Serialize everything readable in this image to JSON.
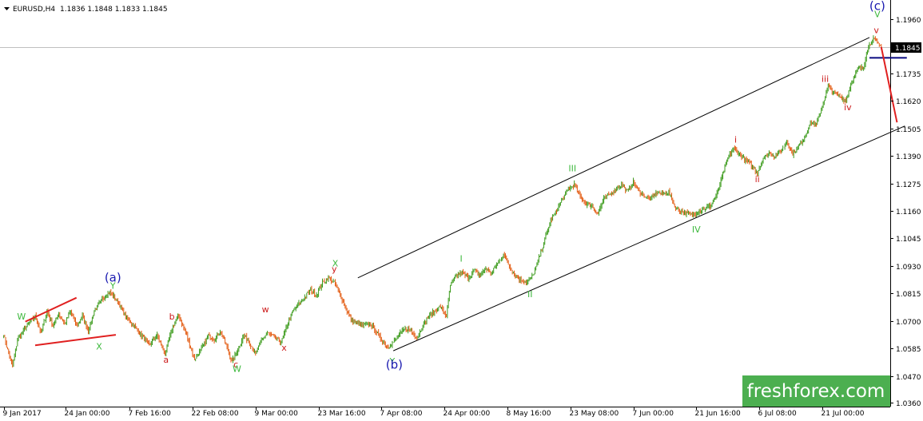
{
  "header": {
    "symbol": "EURUSD,H4",
    "ohlc": "1.1836 1.1848 1.1833 1.1845"
  },
  "brand": {
    "text": "freshforex.com",
    "bg": "#4caf50"
  },
  "chart_data": {
    "type": "candlestick",
    "symbol": "EURUSD",
    "timeframe": "H4",
    "current_price": 1.1845,
    "current_price_label": "1.1845",
    "ylim": [
      1.0345,
      1.2035
    ],
    "y_ticks": [
      {
        "value": 1.196,
        "label": "1.1960"
      },
      {
        "value": 1.1735,
        "label": "1.1735"
      },
      {
        "value": 1.162,
        "label": "1.1620"
      },
      {
        "value": 1.1505,
        "label": "1.1505"
      },
      {
        "value": 1.139,
        "label": "1.1390"
      },
      {
        "value": 1.1275,
        "label": "1.1275"
      },
      {
        "value": 1.116,
        "label": "1.1160"
      },
      {
        "value": 1.1045,
        "label": "1.1045"
      },
      {
        "value": 1.093,
        "label": "1.0930"
      },
      {
        "value": 1.0815,
        "label": "1.0815"
      },
      {
        "value": 1.07,
        "label": "1.0700"
      },
      {
        "value": 1.0585,
        "label": "1.0585"
      },
      {
        "value": 1.047,
        "label": "1.0470"
      },
      {
        "value": 1.036,
        "label": "1.0360"
      }
    ],
    "x_labels": [
      {
        "index": 0,
        "label": "9 Jan 2017"
      },
      {
        "index": 63,
        "label": "24 Jan 00:00"
      },
      {
        "index": 128,
        "label": "7 Feb 16:00"
      },
      {
        "index": 192,
        "label": "22 Feb 08:00"
      },
      {
        "index": 256,
        "label": "9 Mar 00:00"
      },
      {
        "index": 320,
        "label": "23 Mar 16:00"
      },
      {
        "index": 384,
        "label": "7 Apr 08:00"
      },
      {
        "index": 448,
        "label": "24 Apr 00:00"
      },
      {
        "index": 512,
        "label": "8 May 16:00"
      },
      {
        "index": 576,
        "label": "23 May 08:00"
      },
      {
        "index": 640,
        "label": "7 Jun 00:00"
      },
      {
        "index": 704,
        "label": "21 Jun 16:00"
      },
      {
        "index": 768,
        "label": "6 Jul 08:00"
      },
      {
        "index": 832,
        "label": "21 Jul 00:00"
      }
    ],
    "bar_count": 900,
    "up_color": "#3a9a1a",
    "down_color": "#e35a10",
    "price_path": [
      [
        0,
        1.064
      ],
      [
        4,
        1.058
      ],
      [
        9,
        1.051
      ],
      [
        14,
        1.062
      ],
      [
        20,
        1.066
      ],
      [
        26,
        1.069
      ],
      [
        32,
        1.072
      ],
      [
        38,
        1.065
      ],
      [
        44,
        1.074
      ],
      [
        50,
        1.068
      ],
      [
        56,
        1.073
      ],
      [
        62,
        1.069
      ],
      [
        68,
        1.074
      ],
      [
        74,
        1.068
      ],
      [
        80,
        1.072
      ],
      [
        86,
        1.066
      ],
      [
        92,
        1.074
      ],
      [
        100,
        1.079
      ],
      [
        108,
        1.082
      ],
      [
        116,
        1.078
      ],
      [
        124,
        1.072
      ],
      [
        132,
        1.068
      ],
      [
        140,
        1.064
      ],
      [
        148,
        1.06
      ],
      [
        156,
        1.064
      ],
      [
        164,
        1.056
      ],
      [
        172,
        1.068
      ],
      [
        178,
        1.072
      ],
      [
        186,
        1.064
      ],
      [
        194,
        1.054
      ],
      [
        202,
        1.059
      ],
      [
        208,
        1.064
      ],
      [
        214,
        1.062
      ],
      [
        220,
        1.066
      ],
      [
        226,
        1.06
      ],
      [
        232,
        1.053
      ],
      [
        238,
        1.058
      ],
      [
        244,
        1.064
      ],
      [
        250,
        1.061
      ],
      [
        256,
        1.056
      ],
      [
        262,
        1.062
      ],
      [
        268,
        1.065
      ],
      [
        276,
        1.063
      ],
      [
        282,
        1.061
      ],
      [
        288,
        1.068
      ],
      [
        294,
        1.074
      ],
      [
        300,
        1.077
      ],
      [
        306,
        1.08
      ],
      [
        312,
        1.083
      ],
      [
        318,
        1.081
      ],
      [
        324,
        1.086
      ],
      [
        330,
        1.088
      ],
      [
        336,
        1.086
      ],
      [
        342,
        1.081
      ],
      [
        348,
        1.075
      ],
      [
        354,
        1.07
      ],
      [
        360,
        1.069
      ],
      [
        366,
        1.068
      ],
      [
        372,
        1.069
      ],
      [
        378,
        1.066
      ],
      [
        384,
        1.062
      ],
      [
        390,
        1.059
      ],
      [
        396,
        1.061
      ],
      [
        402,
        1.064
      ],
      [
        408,
        1.067
      ],
      [
        414,
        1.066
      ],
      [
        420,
        1.063
      ],
      [
        426,
        1.068
      ],
      [
        432,
        1.072
      ],
      [
        438,
        1.074
      ],
      [
        444,
        1.076
      ],
      [
        450,
        1.072
      ],
      [
        454,
        1.085
      ],
      [
        460,
        1.089
      ],
      [
        466,
        1.09
      ],
      [
        472,
        1.088
      ],
      [
        478,
        1.091
      ],
      [
        484,
        1.089
      ],
      [
        490,
        1.092
      ],
      [
        496,
        1.09
      ],
      [
        502,
        1.094
      ],
      [
        508,
        1.098
      ],
      [
        514,
        1.093
      ],
      [
        520,
        1.089
      ],
      [
        526,
        1.087
      ],
      [
        532,
        1.086
      ],
      [
        538,
        1.089
      ],
      [
        544,
        1.096
      ],
      [
        550,
        1.104
      ],
      [
        556,
        1.112
      ],
      [
        562,
        1.116
      ],
      [
        568,
        1.121
      ],
      [
        574,
        1.125
      ],
      [
        580,
        1.127
      ],
      [
        586,
        1.122
      ],
      [
        592,
        1.119
      ],
      [
        598,
        1.118
      ],
      [
        604,
        1.115
      ],
      [
        610,
        1.121
      ],
      [
        616,
        1.123
      ],
      [
        622,
        1.125
      ],
      [
        628,
        1.127
      ],
      [
        634,
        1.124
      ],
      [
        640,
        1.128
      ],
      [
        646,
        1.124
      ],
      [
        652,
        1.122
      ],
      [
        658,
        1.121
      ],
      [
        664,
        1.124
      ],
      [
        670,
        1.123
      ],
      [
        676,
        1.124
      ],
      [
        682,
        1.118
      ],
      [
        688,
        1.116
      ],
      [
        694,
        1.115
      ],
      [
        700,
        1.114
      ],
      [
        706,
        1.116
      ],
      [
        712,
        1.117
      ],
      [
        718,
        1.118
      ],
      [
        724,
        1.122
      ],
      [
        730,
        1.13
      ],
      [
        736,
        1.138
      ],
      [
        742,
        1.142
      ],
      [
        748,
        1.14
      ],
      [
        754,
        1.137
      ],
      [
        760,
        1.135
      ],
      [
        766,
        1.132
      ],
      [
        772,
        1.138
      ],
      [
        778,
        1.14
      ],
      [
        784,
        1.139
      ],
      [
        790,
        1.141
      ],
      [
        796,
        1.145
      ],
      [
        802,
        1.14
      ],
      [
        808,
        1.143
      ],
      [
        814,
        1.147
      ],
      [
        820,
        1.153
      ],
      [
        826,
        1.152
      ],
      [
        832,
        1.16
      ],
      [
        838,
        1.168
      ],
      [
        844,
        1.165
      ],
      [
        850,
        1.164
      ],
      [
        856,
        1.162
      ],
      [
        862,
        1.17
      ],
      [
        868,
        1.175
      ],
      [
        874,
        1.176
      ],
      [
        878,
        1.184
      ],
      [
        884,
        1.188
      ],
      [
        888,
        1.186
      ],
      [
        892,
        1.1845
      ]
    ],
    "channel": {
      "color": "#000000",
      "upper": {
        "from": [
          360,
          1.088
        ],
        "to": [
          880,
          1.1885
        ]
      },
      "lower": {
        "from": [
          396,
          1.0575
        ],
        "to": [
          916,
          1.1515
        ]
      }
    },
    "triangle_lines": {
      "color": "#e02020",
      "upper": {
        "from": [
          22,
          1.0697
        ],
        "to": [
          74,
          1.0797
        ]
      },
      "lower": {
        "from": [
          32,
          1.0598
        ],
        "to": [
          114,
          1.0642
        ]
      }
    },
    "support_level": {
      "value": 1.18,
      "x_from": 880,
      "x_to": 918,
      "color": "#0a0a80"
    },
    "forecast_arrow": {
      "from": [
        892,
        1.1845
      ],
      "to": [
        908,
        1.153
      ],
      "color": "#e02020"
    },
    "wave_labels": [
      {
        "text": "W",
        "x": 18,
        "y": 1.0706,
        "color": "#3cb83c"
      },
      {
        "text": "X",
        "x": 97,
        "y": 1.058,
        "color": "#3cb83c"
      },
      {
        "text": "(a)",
        "x": 111,
        "y": 1.0865,
        "color": "#1a1ab0"
      },
      {
        "text": "Y",
        "x": 111,
        "y": 1.0835,
        "color": "#3cb83c"
      },
      {
        "text": "b",
        "x": 171,
        "y": 1.0706,
        "color": "#cc1a1a"
      },
      {
        "text": "a",
        "x": 165,
        "y": 1.0525,
        "color": "#cc1a1a"
      },
      {
        "text": "c",
        "x": 236,
        "y": 1.0505,
        "color": "#cc1a1a"
      },
      {
        "text": "W",
        "x": 237,
        "y": 1.0487,
        "color": "#3cb83c"
      },
      {
        "text": "w",
        "x": 266,
        "y": 1.0735,
        "color": "#cc1a1a"
      },
      {
        "text": "x",
        "x": 285,
        "y": 1.0575,
        "color": "#cc1a1a"
      },
      {
        "text": "X",
        "x": 337,
        "y": 1.0927,
        "color": "#3cb83c"
      },
      {
        "text": "y",
        "x": 336,
        "y": 1.0905,
        "color": "#cc1a1a"
      },
      {
        "text": "Y",
        "x": 395,
        "y": 1.0518,
        "color": "#3cb83c"
      },
      {
        "text": "(b)",
        "x": 397,
        "y": 1.05,
        "color": "#1a1ab0"
      },
      {
        "text": "I",
        "x": 465,
        "y": 1.0948,
        "color": "#3cb83c"
      },
      {
        "text": "II",
        "x": 535,
        "y": 1.08,
        "color": "#3cb83c"
      },
      {
        "text": "III",
        "x": 578,
        "y": 1.1325,
        "color": "#3cb83c"
      },
      {
        "text": "IV",
        "x": 704,
        "y": 1.107,
        "color": "#3cb83c"
      },
      {
        "text": "i",
        "x": 744,
        "y": 1.1445,
        "color": "#cc1a1a"
      },
      {
        "text": "ii",
        "x": 766,
        "y": 1.128,
        "color": "#cc1a1a"
      },
      {
        "text": "iii",
        "x": 835,
        "y": 1.17,
        "color": "#cc1a1a"
      },
      {
        "text": "iv",
        "x": 858,
        "y": 1.158,
        "color": "#cc1a1a"
      },
      {
        "text": "(c)",
        "x": 888,
        "y": 1.2,
        "color": "#1a1ab0"
      },
      {
        "text": "V",
        "x": 888,
        "y": 1.197,
        "color": "#3cb83c"
      },
      {
        "text": "v",
        "x": 887,
        "y": 1.1903,
        "color": "#cc1a1a"
      }
    ]
  }
}
